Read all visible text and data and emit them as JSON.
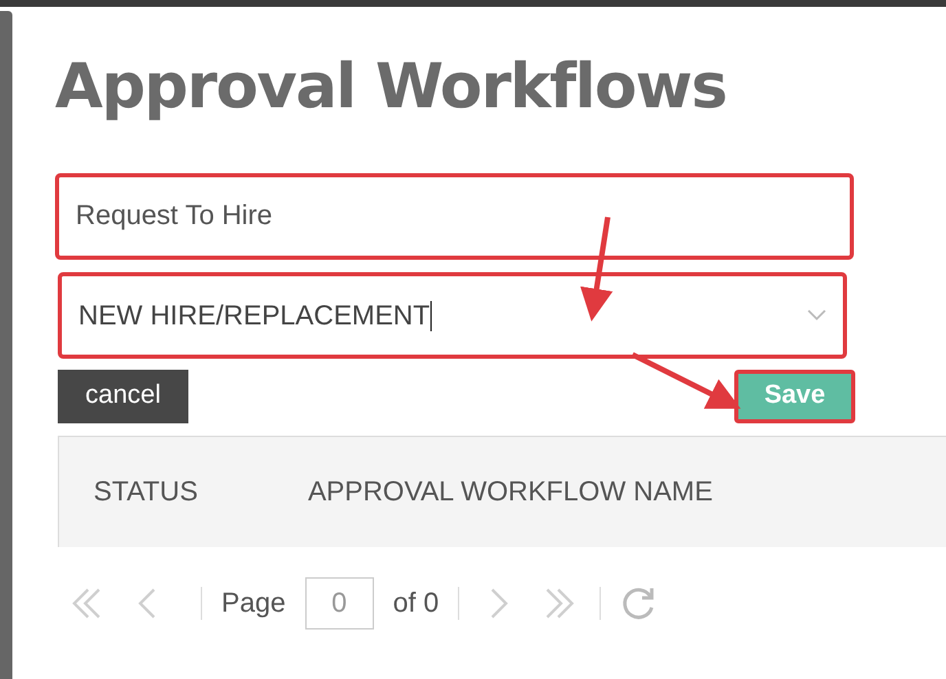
{
  "title": "Approval Workflows",
  "name_field": {
    "value": "Request To Hire"
  },
  "type_select": {
    "value": "NEW HIRE/REPLACEMENT"
  },
  "buttons": [
    {
      "label": "cancel",
      "kind": "cancel"
    },
    {
      "label": "Save",
      "kind": "save"
    }
  ],
  "table": {
    "columns": [
      "STATUS",
      "APPROVAL WORKFLOW NAME"
    ]
  },
  "pager": {
    "page_label": "Page",
    "page_value": "0",
    "of_label": "of 0"
  }
}
